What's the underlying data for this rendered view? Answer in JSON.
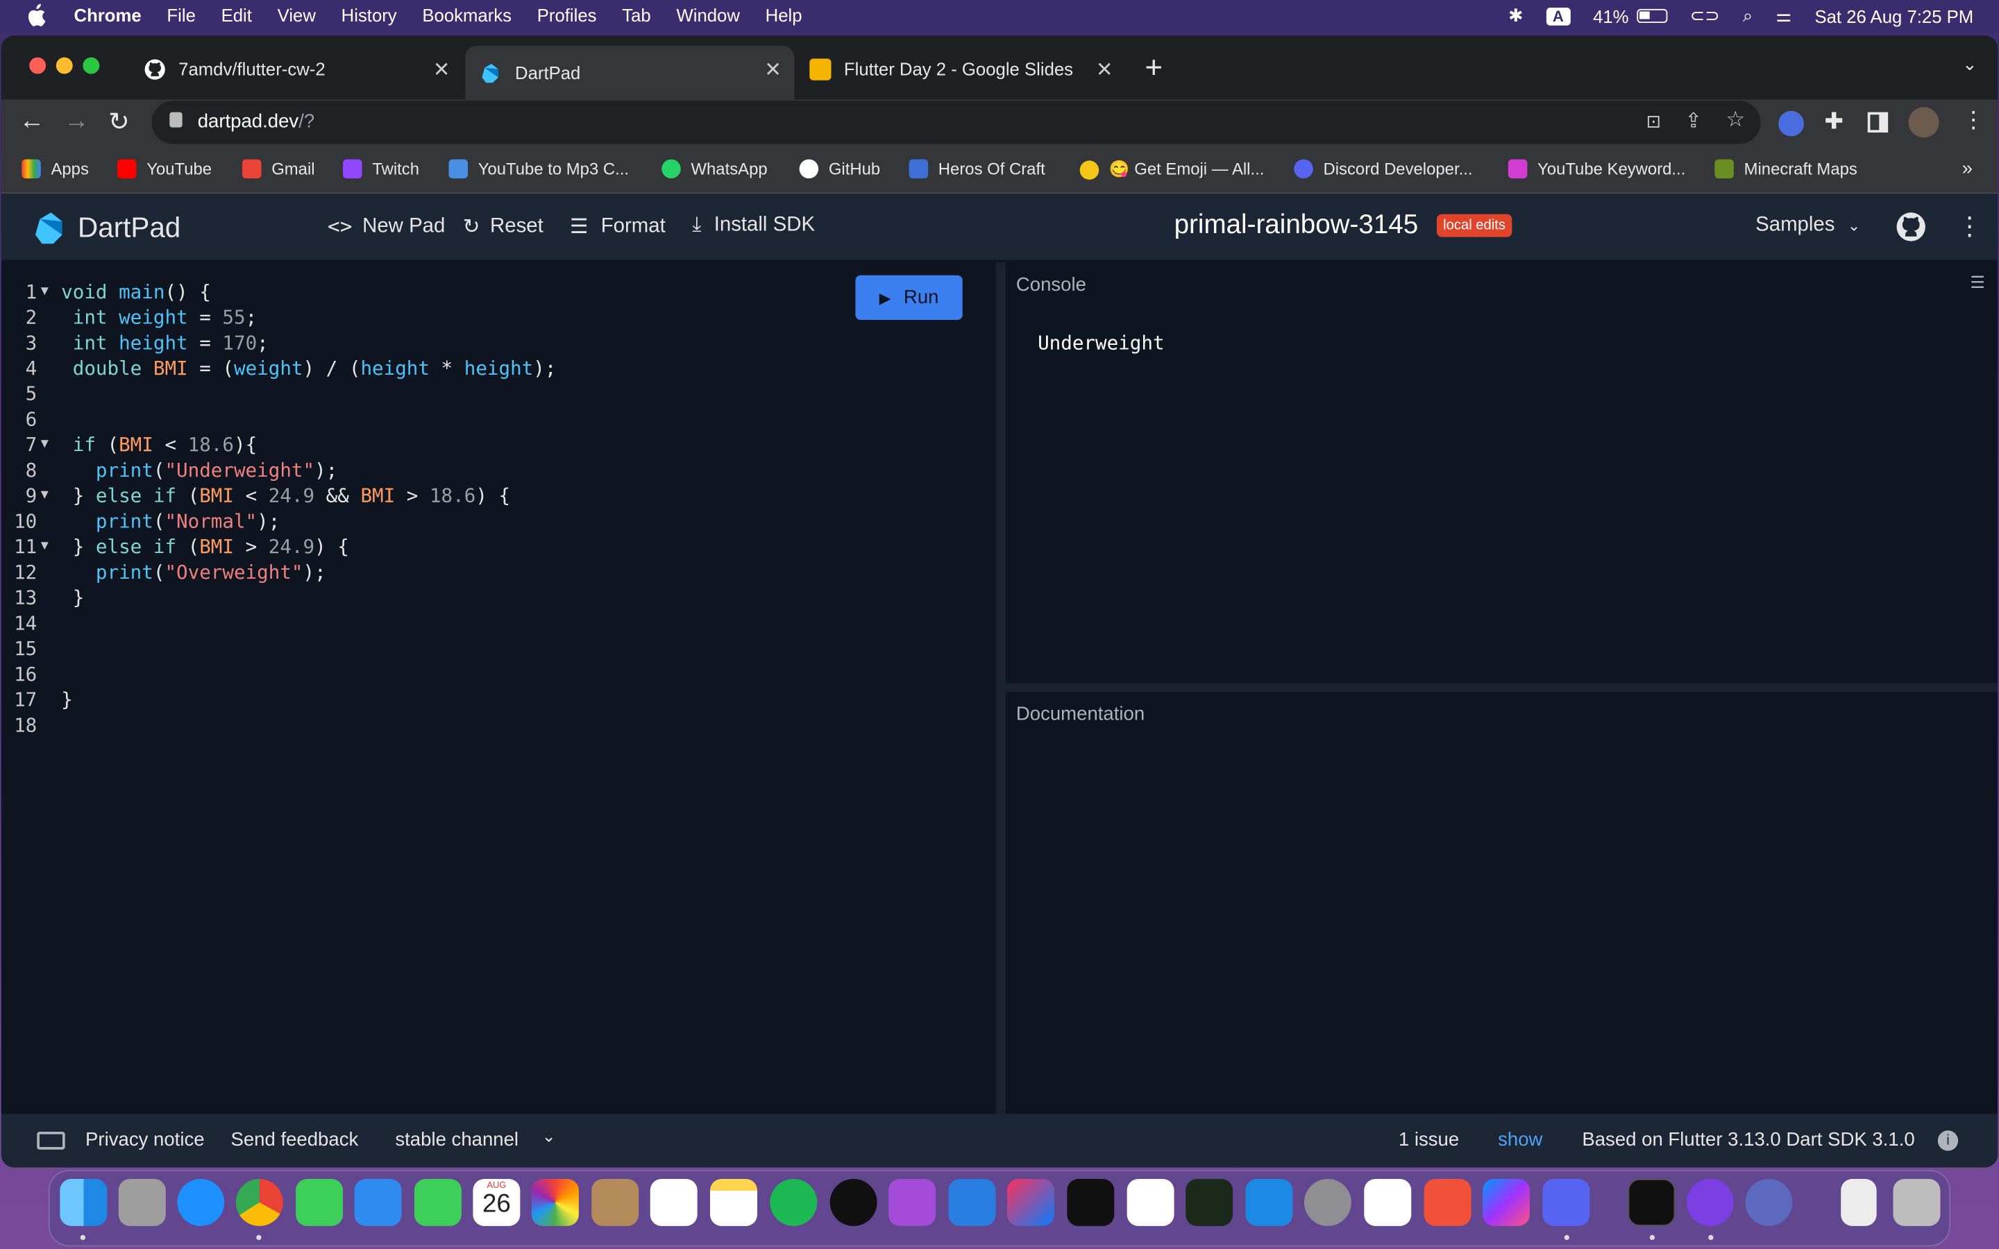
{
  "menubar": {
    "app": "Chrome",
    "items": [
      "File",
      "Edit",
      "View",
      "History",
      "Bookmarks",
      "Profiles",
      "Tab",
      "Window",
      "Help"
    ],
    "battery": "41%",
    "datetime": "Sat 26 Aug  7:25 PM",
    "input_badge": "A"
  },
  "tabs": [
    {
      "title": "7amdv/flutter-cw-2",
      "icon": "github-icon"
    },
    {
      "title": "DartPad",
      "icon": "dart-icon"
    },
    {
      "title": "Flutter Day 2 - Google Slides",
      "icon": "slides-icon"
    }
  ],
  "address": {
    "host": "dartpad.dev",
    "path": "/?"
  },
  "bookmarks": [
    {
      "label": "Apps",
      "color": "#ea4335"
    },
    {
      "label": "YouTube",
      "color": "#ff0000"
    },
    {
      "label": "Gmail",
      "color": "#ea4335"
    },
    {
      "label": "Twitch",
      "color": "#9146ff"
    },
    {
      "label": "YouTube to Mp3 C...",
      "color": "#4a90e2"
    },
    {
      "label": "WhatsApp",
      "color": "#25d366"
    },
    {
      "label": "GitHub",
      "color": "#ffffff"
    },
    {
      "label": "Heros Of Craft",
      "color": "#3d6fd6"
    },
    {
      "label": "😋 Get Emoji — All...",
      "color": "#f5c518"
    },
    {
      "label": "Discord Developer...",
      "color": "#5865f2"
    },
    {
      "label": "YouTube Keyword...",
      "color": "#d23cd2"
    },
    {
      "label": "Minecraft Maps",
      "color": "#6b8e23"
    }
  ],
  "dartpad": {
    "title": "DartPad",
    "new_pad": "New Pad",
    "reset": "Reset",
    "format": "Format",
    "install_sdk": "Install SDK",
    "pad_name": "primal-rainbow-3145",
    "local_edits": "local edits",
    "samples": "Samples",
    "run": "Run",
    "console_title": "Console",
    "console_output": "Underweight",
    "docs_title": "Documentation"
  },
  "code_lines": [
    "void main() {",
    " int weight = 55;",
    " int height = 170;",
    " double BMI = (weight) / (height * height);",
    "",
    "",
    " if (BMI < 18.6){",
    "   print(\"Underweight\");",
    " } else if (BMI < 24.9 && BMI > 18.6) {",
    "   print(\"Normal\");",
    " } else if (BMI > 24.9) {",
    "   print(\"Overweight\");",
    " }",
    "",
    "",
    "",
    "}",
    ""
  ],
  "footer": {
    "privacy": "Privacy notice",
    "feedback": "Send feedback",
    "channel": "stable channel",
    "issues": "1 issue",
    "show": "show",
    "version": "Based on Flutter 3.13.0 Dart SDK 3.1.0"
  },
  "dock": {
    "calendar_month": "AUG",
    "calendar_day": "26"
  }
}
